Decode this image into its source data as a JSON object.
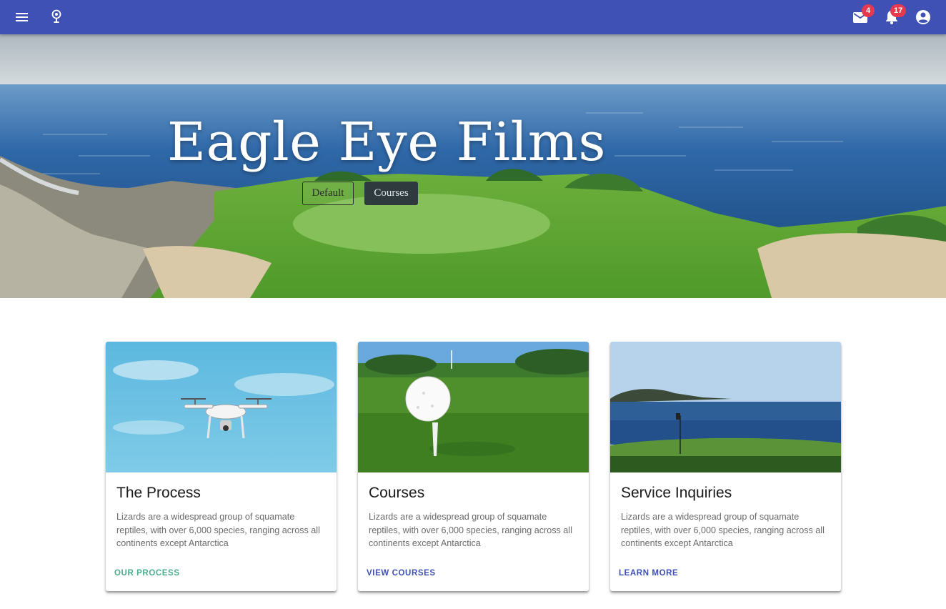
{
  "appbar": {
    "background": "#3f51b5",
    "icons": [
      "menu-icon",
      "location-pin-icon",
      "mail-icon",
      "bell-icon",
      "account-circle-icon"
    ],
    "mail_badge": "4",
    "notifications_badge": "17"
  },
  "hero": {
    "title": "Eagle Eye Films",
    "buttons": {
      "default_label": "Default",
      "courses_label": "Courses"
    }
  },
  "cards": [
    {
      "title": "The Process",
      "text": "Lizards are a widespread group of squamate reptiles, with over 6,000 species, ranging across all continents except Antarctica",
      "action": "OUR PROCESS",
      "action_color": "#4caf8a"
    },
    {
      "title": "Courses",
      "text": "Lizards are a widespread group of squamate reptiles, with over 6,000 species, ranging across all continents except Antarctica",
      "action": "VIEW COURSES",
      "action_color": "#3f51b5"
    },
    {
      "title": "Service Inquiries",
      "text": "Lizards are a widespread group of squamate reptiles, with over 6,000 species, ranging across all continents except Antarctica",
      "action": "LEARN MORE",
      "action_color": "#3f51b5"
    }
  ]
}
